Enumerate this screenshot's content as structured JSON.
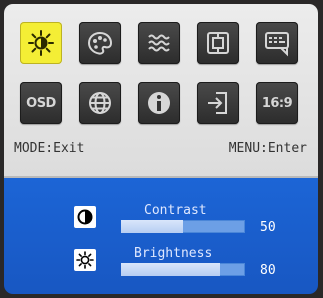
{
  "menu": {
    "icons": [
      {
        "name": "luminance-icon",
        "selected": true
      },
      {
        "name": "image-setup-icon",
        "selected": false
      },
      {
        "name": "color-temp-icon",
        "selected": false
      },
      {
        "name": "image-position-icon",
        "selected": false
      },
      {
        "name": "language-icon",
        "selected": false
      },
      {
        "name": "osd-setup-icon",
        "text": "OSD",
        "selected": false
      },
      {
        "name": "globe-icon",
        "selected": false
      },
      {
        "name": "information-icon",
        "selected": false
      },
      {
        "name": "input-select-icon",
        "selected": false
      },
      {
        "name": "aspect-ratio-icon",
        "text": "16:9",
        "selected": false
      }
    ],
    "footer_left": "MODE:Exit",
    "footer_right": "MENU:Enter"
  },
  "adjustments": [
    {
      "label": "Contrast",
      "value": "50",
      "level": 0.5,
      "icon": "contrast-icon"
    },
    {
      "label": "Brightness",
      "value": "80",
      "level": 0.8,
      "icon": "brightness-icon"
    }
  ],
  "colors": {
    "selected_tile": "#f4ee35",
    "adjust_panel": "#1c65d6",
    "menu_panel": "#e6e6e6"
  }
}
